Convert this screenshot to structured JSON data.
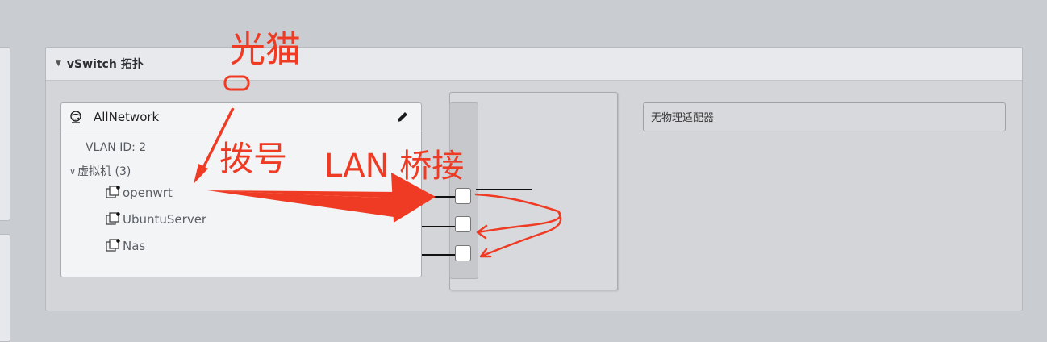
{
  "panel": {
    "title": "vSwitch 拓扑"
  },
  "port_group": {
    "name": "AllNetwork",
    "vlan": "VLAN ID: 2",
    "vm_header": "虚拟机 (3)",
    "vms": [
      "openwrt",
      "UbuntuServer",
      "Nas"
    ]
  },
  "uplink": {
    "adapter_text": "无物理适配器"
  },
  "annotations": {
    "modem": "光猫",
    "dialup": "拨号",
    "lan_bridge": "LAN 桥接"
  },
  "colors": {
    "annotation": "#ef3b24",
    "background": "#c9ccd1"
  }
}
